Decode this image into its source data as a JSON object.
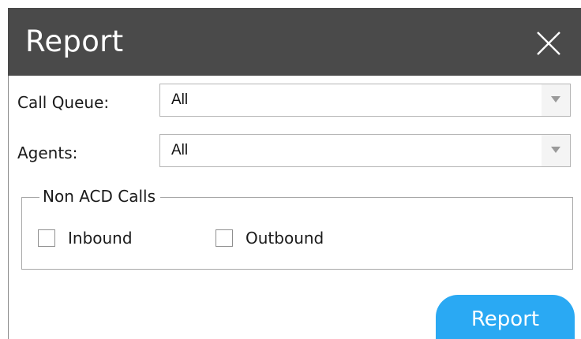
{
  "dialog": {
    "title": "Report",
    "close_icon": "close-icon",
    "colors": {
      "titlebar": "#4a4a4a",
      "accent_button": "#2aa9f3"
    }
  },
  "form": {
    "call_queue": {
      "label": "Call Queue:",
      "value": "All"
    },
    "agents": {
      "label": "Agents:",
      "value": "All"
    },
    "non_acd": {
      "legend": "Non ACD Calls",
      "inbound": {
        "label": "Inbound",
        "checked": false
      },
      "outbound": {
        "label": "Outbound",
        "checked": false
      }
    }
  },
  "actions": {
    "report_label": "Report"
  }
}
